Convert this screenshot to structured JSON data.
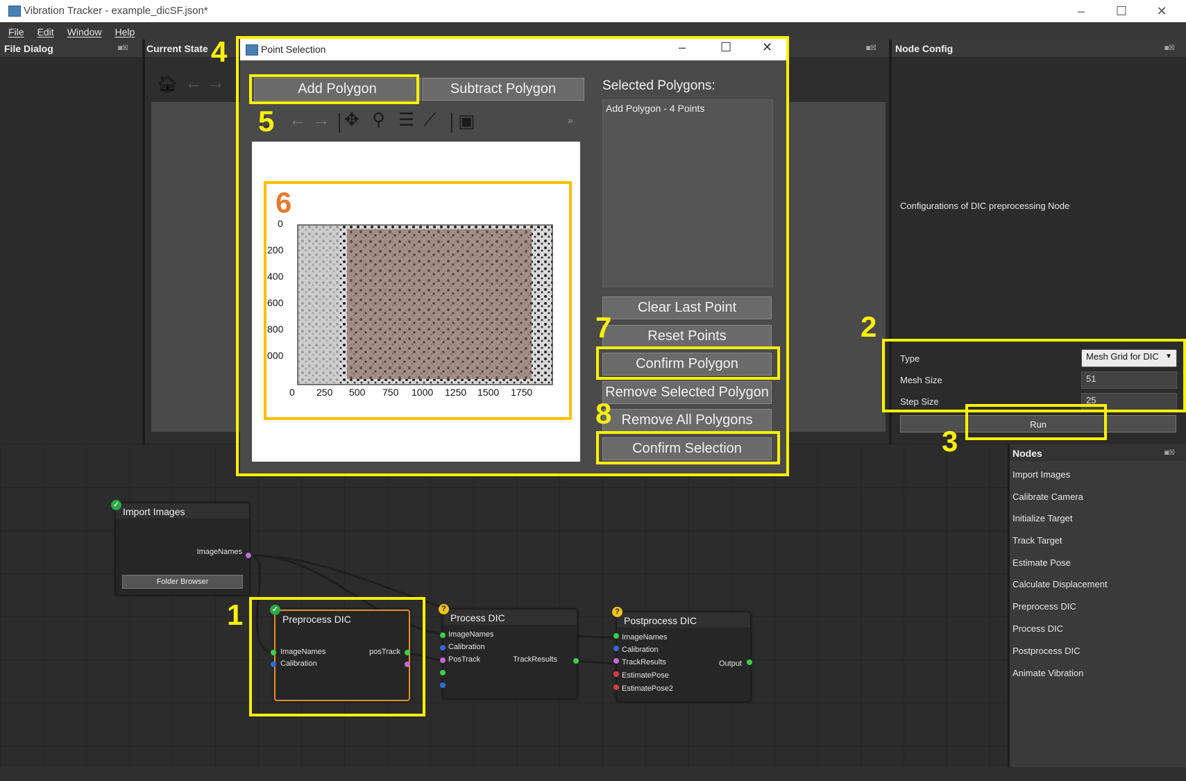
{
  "window": {
    "title": "Vibration Tracker - example_dicSF.json*",
    "minimize": "–",
    "maximize": "☐",
    "close": "✕"
  },
  "menu": [
    "File",
    "Edit",
    "Window",
    "Help"
  ],
  "panels": {
    "file_dialog": "File Dialog",
    "current_state": "Current State",
    "node_config": "Node Config",
    "nodes": "Nodes",
    "dock_buttons": "◙☒"
  },
  "node_config": {
    "description": "Configurations of DIC preprocessing Node",
    "type_label": "Type",
    "type_value": "Mesh Grid for DIC",
    "mesh_label": "Mesh Size",
    "mesh_value": "51",
    "step_label": "Step Size",
    "step_value": "25",
    "run": "Run"
  },
  "nodes_list": [
    "Import Images",
    "Calibrate Camera",
    "Initialize Target",
    "Track Target",
    "Estimate Pose",
    "Calculate Displacement",
    "Preprocess DIC",
    "Process DIC",
    "Postprocess DIC",
    "Animate Vibration"
  ],
  "graph": {
    "import_images": {
      "title": "Import Images",
      "out": "ImageNames",
      "button": "Folder Browser",
      "status": "✓"
    },
    "preprocess": {
      "title": "Preprocess DIC",
      "in1": "ImageNames",
      "in2": "Calibration",
      "out": "posTrack",
      "status": "✓"
    },
    "process": {
      "title": "Process DIC",
      "in1": "ImageNames",
      "in2": "Calibration",
      "in3": "PosTrack",
      "out": "TrackResults",
      "status": "?"
    },
    "postprocess": {
      "title": "Postprocess DIC",
      "in1": "ImageNames",
      "in2": "Calibration",
      "in3": "TrackResults",
      "in4": "EstimatePose",
      "in5": "EstimatePose2",
      "out": "Output",
      "status": "?"
    }
  },
  "dialog": {
    "title": "Point Selection",
    "add_polygon": "Add Polygon",
    "subtract_polygon": "Subtract Polygon",
    "selected_label": "Selected Polygons:",
    "selected_items": [
      "Add Polygon - 4 Points"
    ],
    "clear_last": "Clear Last Point",
    "reset_points": "Reset Points",
    "confirm_polygon": "Confirm Polygon",
    "remove_selected": "Remove Selected Polygon",
    "remove_all": "Remove All Polygons",
    "confirm_selection": "Confirm Selection",
    "more": "»",
    "toolbar_icons": [
      "home-icon",
      "back-arrow-icon",
      "forward-arrow-icon",
      "pan-icon",
      "zoom-icon",
      "configure-icon",
      "edit-axis-icon",
      "save-icon"
    ]
  },
  "plot": {
    "x_ticks": [
      "0",
      "250",
      "500",
      "750",
      "1000",
      "1250",
      "1500",
      "1750"
    ],
    "y_ticks": [
      "0",
      "200",
      "400",
      "600",
      "800",
      "000"
    ]
  },
  "annotations": [
    "1",
    "2",
    "3",
    "4",
    "5",
    "6",
    "7",
    "8"
  ],
  "colors": {
    "highlight": "#fff200",
    "plot_highlight": "#ffbf00",
    "marker6": "#e87a2d",
    "port_green": "#3ad14a",
    "port_blue": "#2e6bd6",
    "port_purple": "#c06ad8",
    "port_red": "#d84040"
  }
}
